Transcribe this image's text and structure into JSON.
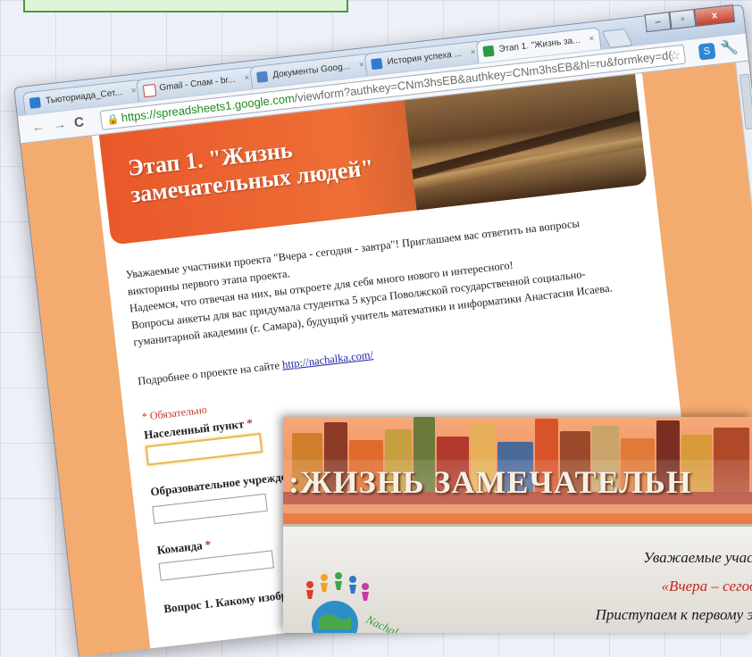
{
  "banner_top": {
    "text": ""
  },
  "browser": {
    "tabs": [
      {
        "label": "Тьюториада_Сет...",
        "icon_color": "#2f7bd1",
        "close": "×"
      },
      {
        "label": "Gmail - Спам - br...",
        "icon_color": "#d8d8d8",
        "close": "×"
      },
      {
        "label": "Документы Goog...",
        "icon_color": "#4f83c7",
        "close": "×"
      },
      {
        "label": "История успеха ...",
        "icon_color": "#2f7bd1",
        "close": "×"
      },
      {
        "label": "Этап 1. \"Жизнь за...",
        "icon_color": "#2c9a45",
        "close": "×",
        "active": true
      }
    ],
    "window_buttons": {
      "minimize": "–",
      "maximize": "▫",
      "close": "x"
    },
    "nav": {
      "back": "←",
      "forward": "→",
      "reload": "C"
    },
    "url_host": "https://spreadsheets1.google.com",
    "url_rest": "/viewform?authkey=CNm3hsEB&authkey=CNm3hsEB&hl=ru&formkey=d(",
    "star": "☆",
    "wrench": "🔧"
  },
  "form": {
    "title": "Этап 1. \"Жизнь замечательных людей\"",
    "description": [
      "Уважаемые участники проекта \"Вчера - сегодня - завтра\"! Приглашаем вас ответить на вопросы",
      "викторины первого этапа проекта.",
      "Надеемся, что отвечая на них, вы откроете для себя  много нового и интересного!",
      "Вопросы анкеты для вас придумала студентка 5 курса Поволжской государственной социально-",
      "гуманитарной академии (г. Самара), будущий учитель математики и информатики Анастасия Исаева."
    ],
    "more_prefix": "Подробнее  о проекте на сайте",
    "more_link": "http://nachalka.com/",
    "required_note": "* Обязательно",
    "questions": [
      {
        "label": "Населенный пункт",
        "required": "*"
      },
      {
        "label": "Образовательное учрежде",
        "required": ""
      },
      {
        "label": "Команда",
        "required": "*"
      },
      {
        "label": "Вопрос 1. Какому изобр",
        "required": ""
      }
    ]
  },
  "slide": {
    "title": ":ЖИЗНЬ  ЗАМЕЧАТЕЛЬН",
    "lines": [
      {
        "text": "Уважаемые участ",
        "color": "#1a1a1a"
      },
      {
        "text": "«Вчера – сегодн",
        "color": "#c0281e"
      },
      {
        "text": "Приступаем к первому эт",
        "color": "#1a1a1a"
      }
    ],
    "logo_text": "Nachal"
  },
  "colors": {
    "form_background": "#f4ab6f",
    "header_orange": "#e9582a",
    "required_red": "#c0392b",
    "url_green": "#1f8a21"
  }
}
